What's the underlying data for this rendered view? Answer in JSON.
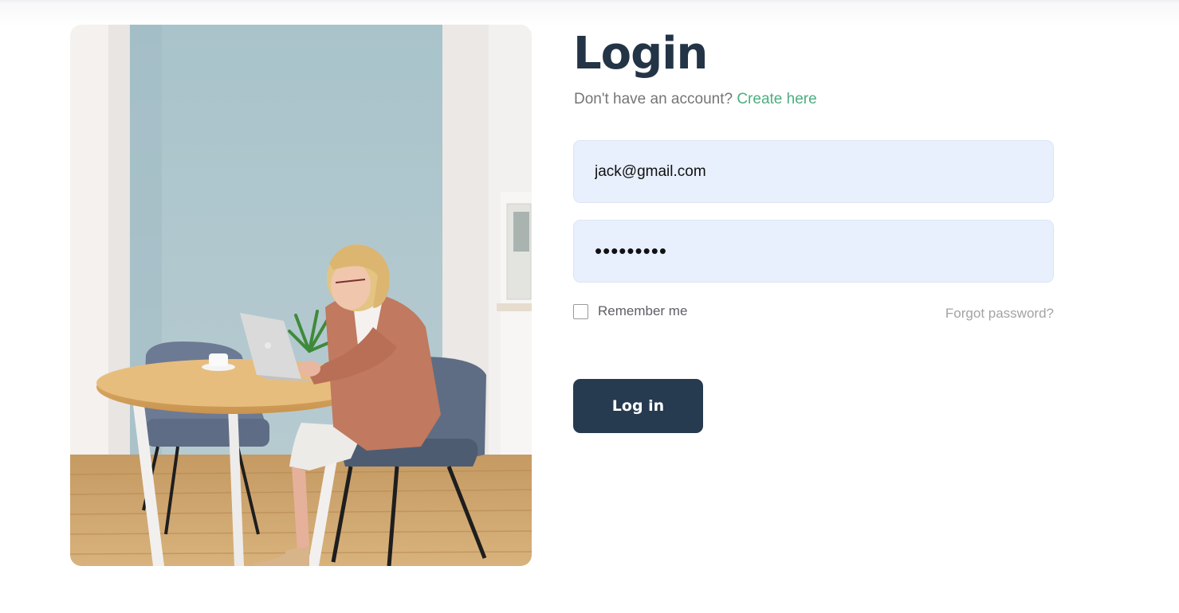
{
  "login": {
    "title": "Login",
    "subtitle_prefix": "Don't have an account?",
    "create_link": "Create here",
    "email_value": "jack@gmail.com",
    "password_value": "•••••••••",
    "remember_label": "Remember me",
    "forgot_label": "Forgot password?",
    "submit_label": "Log in"
  },
  "colors": {
    "title": "#243447",
    "link": "#4caf7f",
    "field_bg": "#e8f0fe",
    "button_bg": "#263a50"
  },
  "image": {
    "subject": "woman working on laptop at round wooden table"
  }
}
